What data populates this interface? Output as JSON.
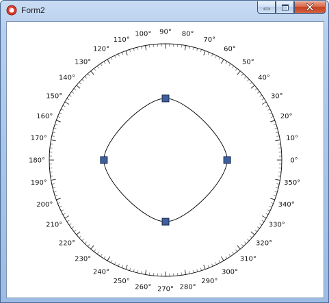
{
  "window": {
    "title": "Form2",
    "icon": "red-circle-app-icon",
    "caption_buttons": [
      "minimize-icon",
      "maximize-icon",
      "close-icon"
    ]
  },
  "polar_chart": {
    "angle_labels": [
      "0°",
      "10°",
      "20°",
      "30°",
      "40°",
      "50°",
      "60°",
      "70°",
      "80°",
      "90°",
      "100°",
      "110°",
      "120°",
      "130°",
      "140°",
      "150°",
      "160°",
      "170°",
      "180°",
      "190°",
      "200°",
      "210°",
      "220°",
      "230°",
      "240°",
      "250°",
      "260°",
      "270°",
      "280°",
      "290°",
      "300°",
      "310°",
      "320°",
      "330°",
      "340°",
      "350°"
    ],
    "colors": {
      "ring": "#111111",
      "curve": "#111111",
      "handle_fill": "#3d5f9c",
      "handle_stroke": "#1a2a4a"
    }
  },
  "chart_data": {
    "type": "line",
    "coordinate_system": "polar",
    "theta_ticks_deg": [
      0,
      10,
      20,
      30,
      40,
      50,
      60,
      70,
      80,
      90,
      100,
      110,
      120,
      130,
      140,
      150,
      160,
      170,
      180,
      190,
      200,
      210,
      220,
      230,
      240,
      250,
      260,
      270,
      280,
      290,
      300,
      310,
      320,
      330,
      340,
      350
    ],
    "r_max": 1.0,
    "control_points": [
      {
        "theta_deg": 0,
        "r": 0.53
      },
      {
        "theta_deg": 90,
        "r": 0.53
      },
      {
        "theta_deg": 180,
        "r": 0.53
      },
      {
        "theta_deg": 270,
        "r": 0.53
      }
    ],
    "curve_style": "smooth closed",
    "grid": false,
    "legend": "none"
  }
}
